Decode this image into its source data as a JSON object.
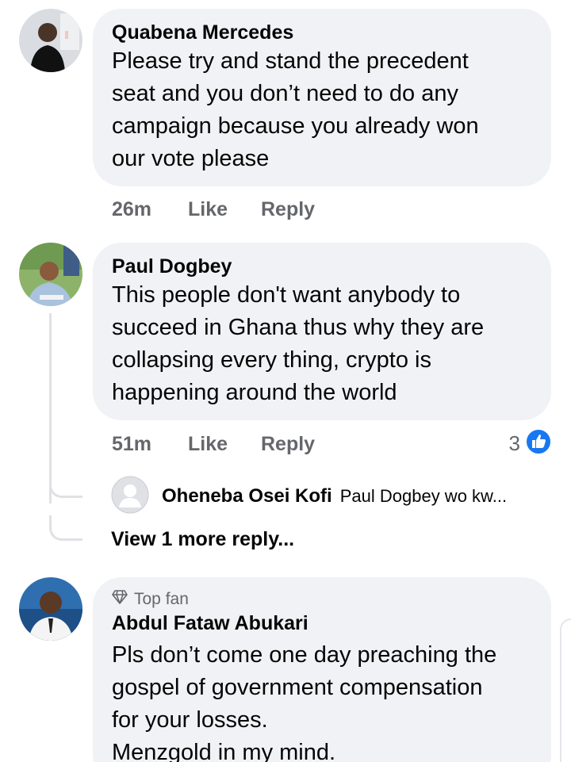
{
  "comments": [
    {
      "author": "Quabena Mercedes",
      "text_lines": [
        "Please try and stand the precedent",
        "seat and you don’t need to do any",
        "campaign because you already won",
        "our vote please"
      ],
      "time": "26m",
      "like_label": "Like",
      "reply_label": "Reply"
    },
    {
      "author": "Paul Dogbey",
      "text_lines": [
        "This people don't want anybody to",
        "succeed in Ghana thus why they are",
        "collapsing every thing, crypto is",
        "happening around the world"
      ],
      "time": "51m",
      "like_label": "Like",
      "reply_label": "Reply",
      "reaction_count": "3",
      "reaction_icon": "like-icon",
      "reply_preview": {
        "author": "Oheneba Osei Kofi",
        "text": "Paul Dogbey wo kw..."
      },
      "view_more": "View 1 more reply..."
    },
    {
      "badge": "Top fan",
      "badge_icon": "diamond-icon",
      "author": "Abdul Fataw Abukari",
      "text_lines": [
        "Pls don’t come one day preaching the",
        "gospel of government compensation",
        "for your losses.",
        "Menzgold in my mind."
      ]
    }
  ],
  "colors": {
    "bubble": "#f0f2f5",
    "meta_text": "#65676b",
    "like_blue": "#1877f2",
    "thread_line": "#dfe1e5"
  }
}
